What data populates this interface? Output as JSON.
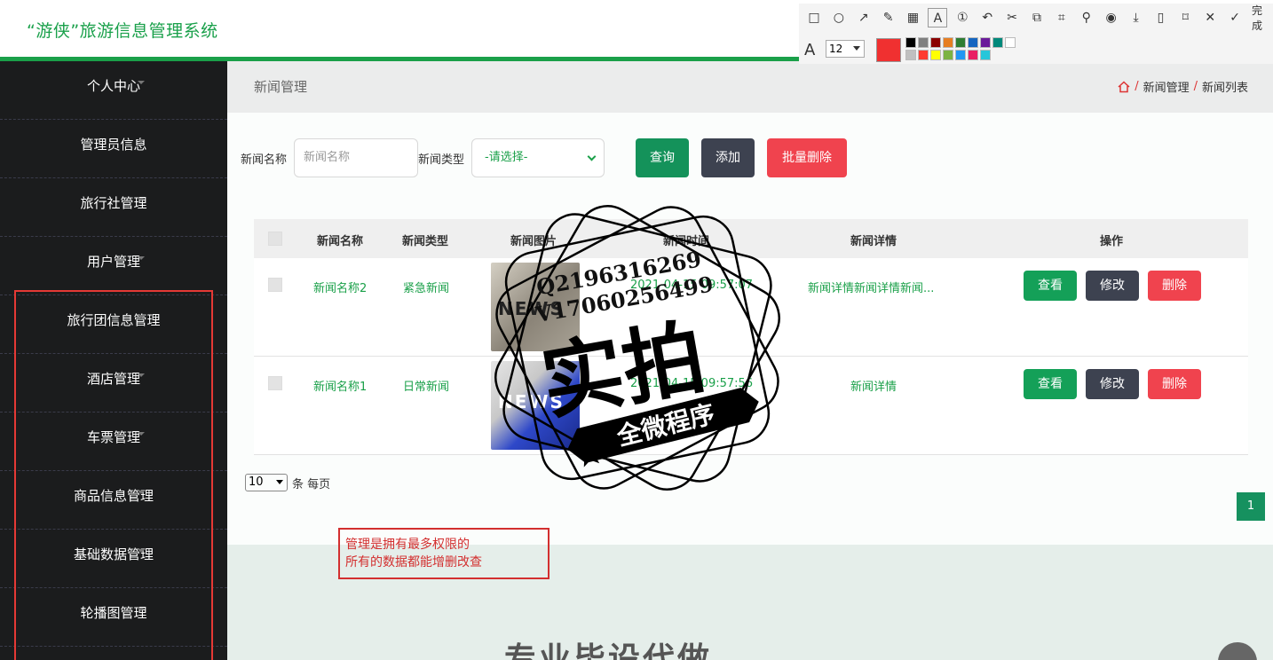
{
  "header": {
    "title": "“游侠”旅游信息管理系统"
  },
  "sidebar": {
    "items": [
      {
        "label": "个人中心"
      },
      {
        "label": "管理员信息"
      },
      {
        "label": "旅行社管理"
      },
      {
        "label": "用户管理"
      },
      {
        "label": "旅行团信息管理"
      },
      {
        "label": "酒店管理"
      },
      {
        "label": "车票管理"
      },
      {
        "label": "商品信息管理"
      },
      {
        "label": "基础数据管理"
      },
      {
        "label": "轮播图管理"
      }
    ]
  },
  "titlebar": {
    "page_title": "新闻管理",
    "breadcrumb": [
      "新闻管理",
      "新闻列表"
    ],
    "sep": "/"
  },
  "search": {
    "name_label": "新闻名称",
    "name_placeholder": "新闻名称",
    "type_label": "新闻类型",
    "type_selected": "-请选择-",
    "query_label": "查询",
    "add_label": "添加",
    "batch_delete_label": "批量删除"
  },
  "table": {
    "headers": [
      "新闻名称",
      "新闻类型",
      "新闻图片",
      "新闻时间",
      "新闻详情",
      "操作"
    ],
    "rows": [
      {
        "name": "新闻名称2",
        "type": "紧急新闻",
        "image_text": "NEWS",
        "time": "2021-04-15 09:57:07",
        "detail": "新闻详情新闻详情新闻..."
      },
      {
        "name": "新闻名称1",
        "type": "日常新闻",
        "image_text": "NEWS",
        "time": "2021-04-15 09:57:56",
        "detail": "新闻详情"
      }
    ],
    "actions": {
      "view": "查看",
      "edit": "修改",
      "delete": "删除"
    }
  },
  "pager": {
    "page_size": "10",
    "per_page_label": "条 每页",
    "current_page": "1"
  },
  "lower": {
    "heading": "专业毕设代做",
    "top_button": "Top"
  },
  "note": {
    "line1": "管理是拥有最多权限的",
    "line2": "所有的数据都能增删改查"
  },
  "anno_toolbar": {
    "done_label": "完成",
    "font_size": "12",
    "current_color": "#f03030",
    "palette": [
      "#000000",
      "#808080",
      "#8b0000",
      "#e67e22",
      "#2e7d32",
      "#1565c0",
      "#6a1b9a",
      "#00897b",
      "#ffffff",
      "#c0c0c0",
      "#ff3b30",
      "#ffff00",
      "#7cb342",
      "#2196f3",
      "#e91e63",
      "#26c6da"
    ]
  },
  "watermark": {
    "line1": "Q2196316269",
    "line2": "V17060256499",
    "big": "实拍",
    "ribbon": "全微程序"
  },
  "colors": {
    "brand": "#1aa049",
    "danger": "#f0434e",
    "dark": "#3d4250",
    "sidebar_bg": "#1b1c1d"
  }
}
